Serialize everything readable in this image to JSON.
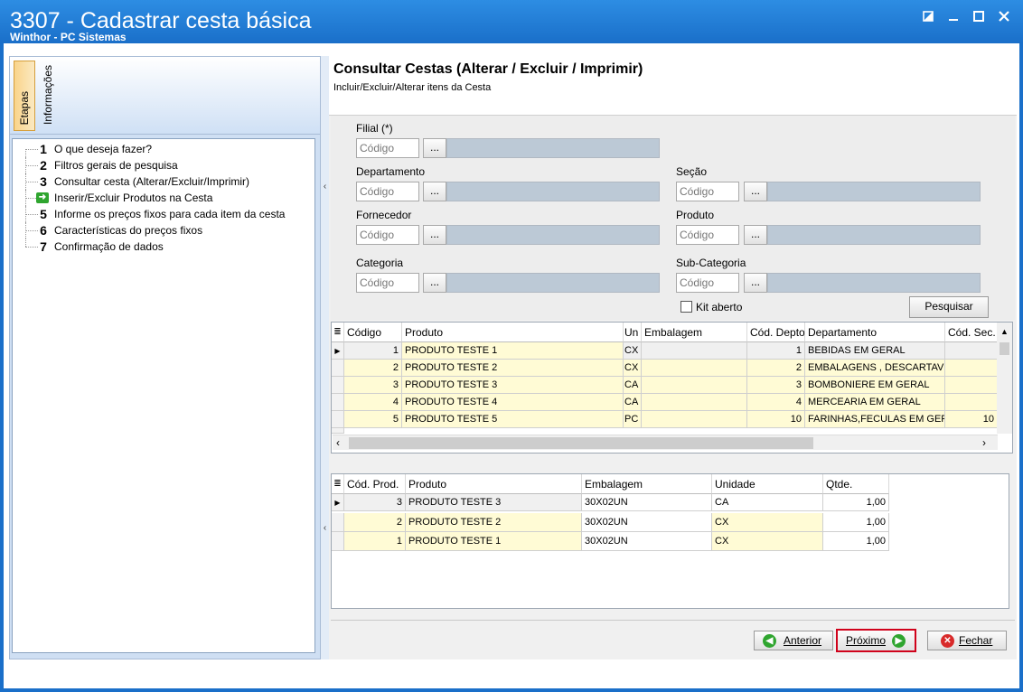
{
  "window": {
    "title": "3307 - Cadastrar cesta básica",
    "subtitle": "Winthor - PC Sistemas",
    "controls": [
      "restore-icon",
      "minimize-icon",
      "maximize-icon",
      "close-icon"
    ]
  },
  "left_panel": {
    "tabs": [
      "Etapas",
      "Informações"
    ],
    "active_tab": "Etapas",
    "steps": [
      {
        "num": "1",
        "label": "O que deseja fazer?"
      },
      {
        "num": "2",
        "label": "Filtros gerais de pesquisa"
      },
      {
        "num": "3",
        "label": "Consultar cesta (Alterar/Excluir/Imprimir)"
      },
      {
        "num": "",
        "label": "Inserir/Excluir Produtos na Cesta",
        "icon": "green-arrow-icon"
      },
      {
        "num": "5",
        "label": "Informe os preços fixos para cada item da cesta"
      },
      {
        "num": "6",
        "label": "Características do preços fixos"
      },
      {
        "num": "7",
        "label": "Confirmação de dados"
      }
    ]
  },
  "header": {
    "title": "Consultar Cestas (Alterar / Excluir / Imprimir)",
    "subtitle": "Incluir/Excluir/Alterar itens da Cesta"
  },
  "filters": {
    "code_placeholder": "Código",
    "lookup_button": "...",
    "filial": {
      "label": "Filial (*)"
    },
    "departamento": {
      "label": "Departamento"
    },
    "secao": {
      "label": "Seção"
    },
    "fornecedor": {
      "label": "Fornecedor"
    },
    "produto": {
      "label": "Produto"
    },
    "categoria": {
      "label": "Categoria"
    },
    "subcategoria": {
      "label": "Sub-Categoria"
    },
    "kit_aberto": {
      "label": "Kit aberto",
      "checked": false
    },
    "pesquisar": "Pesquisar"
  },
  "products_grid": {
    "columns": [
      "Código",
      "Produto",
      "Un",
      "Embalagem",
      "Cód. Depto",
      "Departamento",
      "Cód. Sec."
    ],
    "rows": [
      [
        "1",
        "PRODUTO TESTE 1",
        "CX",
        "",
        "1",
        "BEBIDAS EM GERAL",
        ""
      ],
      [
        "2",
        "PRODUTO TESTE 2",
        "CX",
        "",
        "2",
        "EMBALAGENS , DESCARTAVEIS",
        ""
      ],
      [
        "3",
        "PRODUTO TESTE 3",
        "CA",
        "",
        "3",
        "BOMBONIERE EM GERAL",
        ""
      ],
      [
        "4",
        "PRODUTO TESTE 4",
        "CA",
        "",
        "4",
        "MERCEARIA EM GERAL",
        ""
      ],
      [
        "5",
        "PRODUTO TESTE 5",
        "PC",
        "",
        "10",
        "FARINHAS,FECULAS EM GERAL",
        "10"
      ]
    ]
  },
  "basket_grid": {
    "columns": [
      "Cód. Prod.",
      "Produto",
      "Embalagem",
      "Unidade",
      "Qtde."
    ],
    "rows": [
      [
        "3",
        "PRODUTO TESTE 3",
        "30X02UN",
        "CA",
        "1,00"
      ],
      [
        "2",
        "PRODUTO TESTE 2",
        "30X02UN",
        "CX",
        "1,00"
      ],
      [
        "1",
        "PRODUTO TESTE 1",
        "30X02UN",
        "CX",
        "1,00"
      ]
    ]
  },
  "footer": {
    "anterior": "Anterior",
    "proximo": "Próximo",
    "fechar": "Fechar",
    "highlight_color": "#d0021b"
  }
}
